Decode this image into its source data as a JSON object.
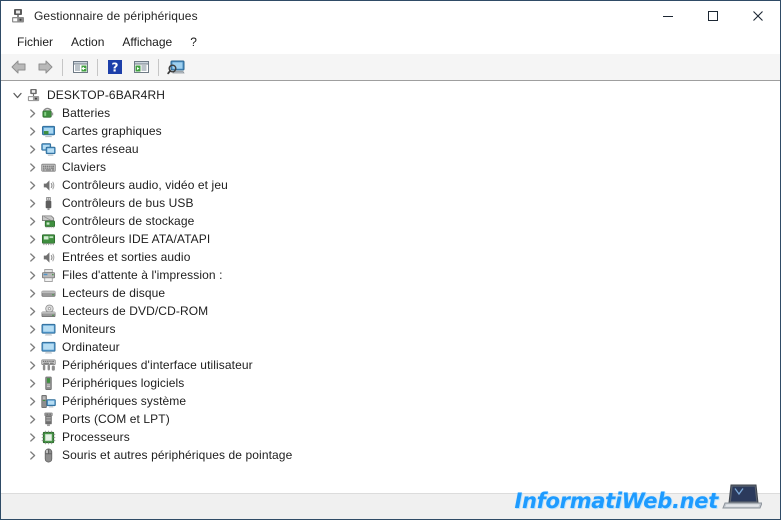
{
  "window": {
    "title": "Gestionnaire de périphériques",
    "title_icon": "device-manager-icon",
    "controls": {
      "minimize": "minimize-icon",
      "maximize": "maximize-icon",
      "close": "close-icon"
    },
    "border_color": "#2f4b66"
  },
  "menubar": {
    "items": [
      {
        "label": "Fichier"
      },
      {
        "label": "Action"
      },
      {
        "label": "Affichage"
      },
      {
        "label": "?"
      }
    ]
  },
  "toolbar": {
    "buttons": [
      {
        "name": "back-button",
        "icon": "back-arrow-icon",
        "type": "button"
      },
      {
        "name": "forward-button",
        "icon": "forward-arrow-icon",
        "type": "button"
      },
      {
        "name": "separator-1",
        "icon": "separator",
        "type": "separator"
      },
      {
        "name": "properties-button",
        "icon": "properties-icon",
        "type": "button"
      },
      {
        "name": "separator-2",
        "icon": "separator",
        "type": "separator"
      },
      {
        "name": "help-button",
        "icon": "help-question-icon",
        "type": "button"
      },
      {
        "name": "update-driver-button",
        "icon": "update-driver-icon",
        "type": "button"
      },
      {
        "name": "separator-3",
        "icon": "separator",
        "type": "separator"
      },
      {
        "name": "scan-hardware-changes-button",
        "icon": "scan-hardware-icon",
        "type": "button"
      }
    ]
  },
  "tree": {
    "root": {
      "label": "DESKTOP-6BAR4RH",
      "icon": "computer-root-icon",
      "expanded": true,
      "chevron": "chevron-down"
    },
    "nodes": [
      {
        "label": "Batteries",
        "icon": "battery-icon",
        "chevron": "chevron-right"
      },
      {
        "label": "Cartes graphiques",
        "icon": "display-adapter-icon",
        "chevron": "chevron-right"
      },
      {
        "label": "Cartes réseau",
        "icon": "network-adapter-icon",
        "chevron": "chevron-right"
      },
      {
        "label": "Claviers",
        "icon": "keyboard-icon",
        "chevron": "chevron-right"
      },
      {
        "label": "Contrôleurs audio, vidéo et jeu",
        "icon": "speaker-icon",
        "chevron": "chevron-right"
      },
      {
        "label": "Contrôleurs de bus USB",
        "icon": "usb-icon",
        "chevron": "chevron-right"
      },
      {
        "label": "Contrôleurs de stockage",
        "icon": "storage-controller-icon",
        "chevron": "chevron-right"
      },
      {
        "label": "Contrôleurs IDE ATA/ATAPI",
        "icon": "ide-controller-icon",
        "chevron": "chevron-right"
      },
      {
        "label": "Entrées et sorties audio",
        "icon": "speaker-icon",
        "chevron": "chevron-right"
      },
      {
        "label": "Files d'attente à l'impression :",
        "icon": "printer-icon",
        "chevron": "chevron-right"
      },
      {
        "label": "Lecteurs de disque",
        "icon": "disk-drive-icon",
        "chevron": "chevron-right"
      },
      {
        "label": "Lecteurs de DVD/CD-ROM",
        "icon": "dvd-drive-icon",
        "chevron": "chevron-right"
      },
      {
        "label": "Moniteurs",
        "icon": "monitor-icon",
        "chevron": "chevron-right"
      },
      {
        "label": "Ordinateur",
        "icon": "computer-icon",
        "chevron": "chevron-right"
      },
      {
        "label": "Périphériques d'interface utilisateur",
        "icon": "hid-icon",
        "chevron": "chevron-right"
      },
      {
        "label": "Périphériques logiciels",
        "icon": "software-device-icon",
        "chevron": "chevron-right"
      },
      {
        "label": "Périphériques système",
        "icon": "system-device-icon",
        "chevron": "chevron-right"
      },
      {
        "label": "Ports (COM et LPT)",
        "icon": "port-icon",
        "chevron": "chevron-right"
      },
      {
        "label": "Processeurs",
        "icon": "processor-icon",
        "chevron": "chevron-right"
      },
      {
        "label": "Souris et autres périphériques de pointage",
        "icon": "mouse-icon",
        "chevron": "chevron-right"
      }
    ]
  },
  "statusbar": {
    "text": ""
  },
  "watermark": {
    "text": "InformatiWeb.net",
    "icon": "laptop-icon",
    "color": "#1e9bff"
  }
}
